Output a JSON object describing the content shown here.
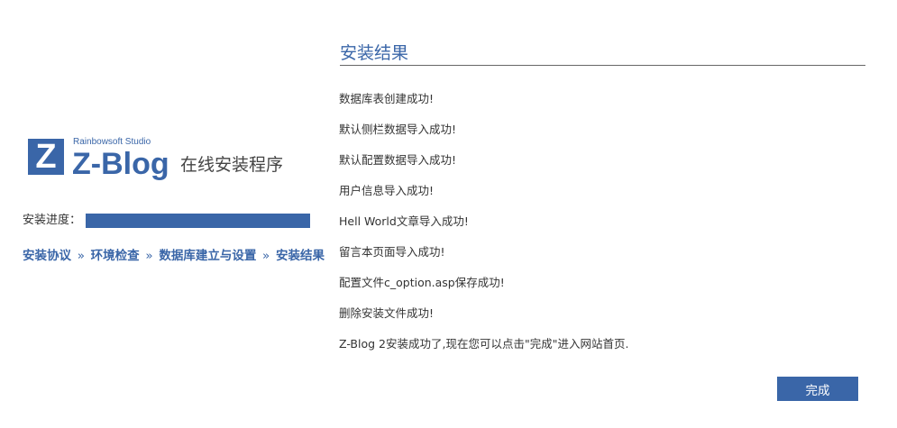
{
  "logo": {
    "square_letter": "Z",
    "studio": "Rainbowsoft Studio",
    "name": "Z-Blog",
    "subtitle": "在线安装程序"
  },
  "progress": {
    "label": "安装进度：",
    "value": 1.0,
    "color": "#3a66a8"
  },
  "steps": {
    "items": [
      "安装协议",
      "环境检查",
      "数据库建立与设置",
      "安装结果"
    ],
    "separator": "»"
  },
  "result": {
    "title": "安装结果",
    "messages": [
      "数据库表创建成功!",
      "默认侧栏数据导入成功!",
      "默认配置数据导入成功!",
      "用户信息导入成功!",
      "Hell World文章导入成功!",
      "留言本页面导入成功!",
      "配置文件c_option.asp保存成功!",
      "删除安装文件成功!",
      "Z-Blog 2安装成功了,现在您可以点击\"完成\"进入网站首页."
    ]
  },
  "finish_button": {
    "label": "完成"
  },
  "colors": {
    "accent": "#3a66a8",
    "background": "#ffffff",
    "text": "#333333"
  }
}
